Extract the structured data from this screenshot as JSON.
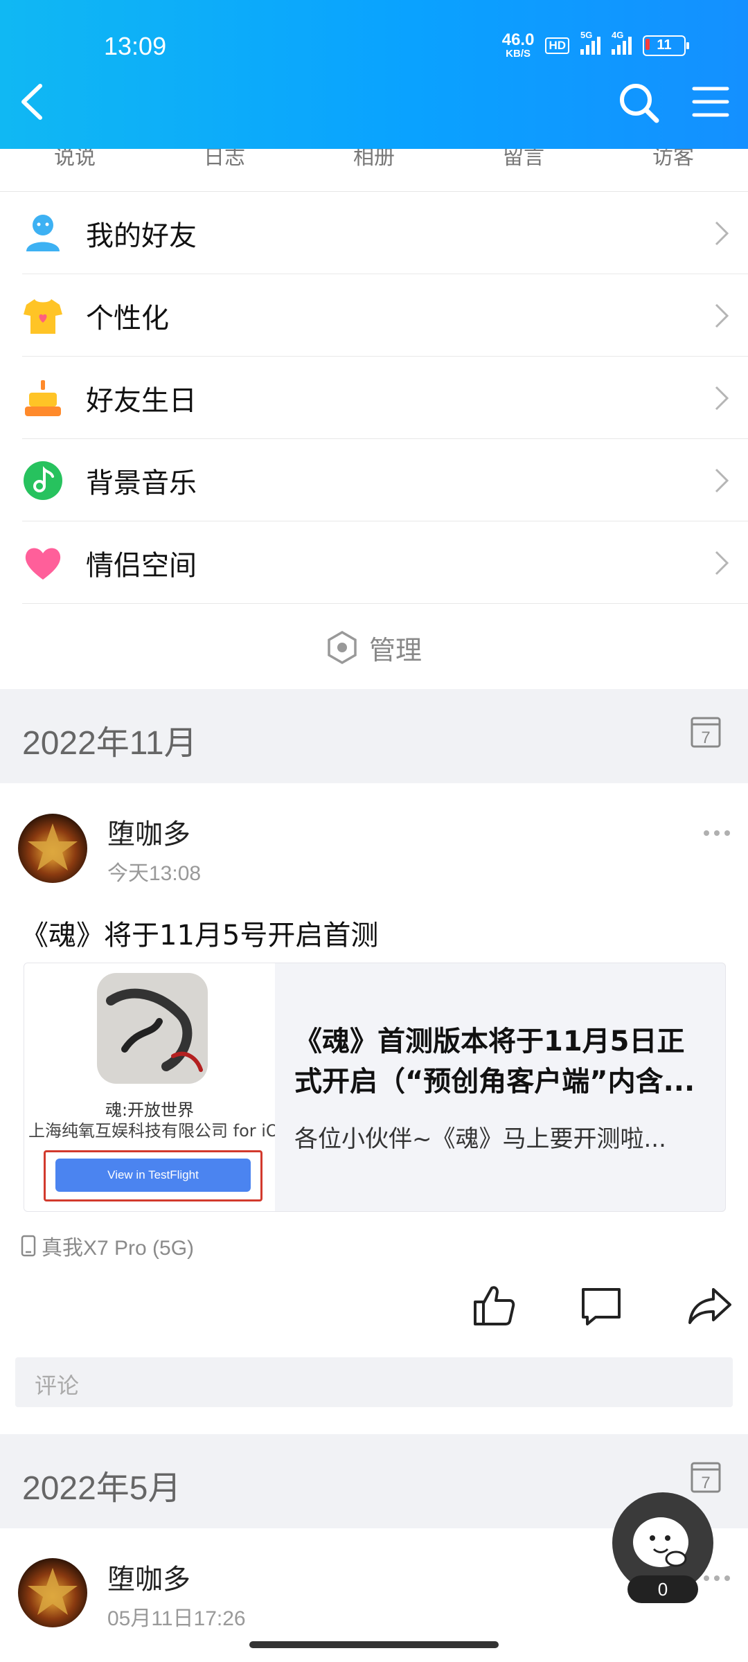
{
  "status_bar": {
    "time": "13:09",
    "net_speed": "46.0",
    "net_unit": "KB/S",
    "hd": "HD",
    "sig1_label": "5G",
    "sig2_label": "4G",
    "battery": "11"
  },
  "tabs": [
    "说说",
    "日志",
    "相册",
    "留言",
    "访客"
  ],
  "menu": [
    {
      "label": "我的好友",
      "icon": "friends-icon",
      "color": "#3db1f3"
    },
    {
      "label": "个性化",
      "icon": "tshirt-icon",
      "color": "#ffc426"
    },
    {
      "label": "好友生日",
      "icon": "birthday-cake-icon",
      "color": "#ff8a2b"
    },
    {
      "label": "背景音乐",
      "icon": "music-note-icon",
      "color": "#27c25e"
    },
    {
      "label": "情侣空间",
      "icon": "heart-icon",
      "color": "#ff5f9a"
    }
  ],
  "manage_label": "管理",
  "months": {
    "first": "2022年11月",
    "second": "2022年5月"
  },
  "calendar_day": "7",
  "post1": {
    "author": "堕咖多",
    "time": "今天13:08",
    "text": "《魂》将于11月5号开启首测",
    "card": {
      "app_name": "魂:开放世界",
      "app_company": "上海纯氧互娱科技有限公司 for iOS",
      "tf_button": "View in TestFlight",
      "title": "《魂》首测版本将于11月5日正式开启（“预创角客户端”内含...",
      "desc": "各位小伙伴~《魂》马上要开测啦..."
    },
    "device": "真我X7 Pro (5G)",
    "comment_placeholder": "评论"
  },
  "post2": {
    "author": "堕咖多",
    "time": "05月11日17:26"
  },
  "floater_count": "0",
  "colors": {
    "topbar": "#10b8f3",
    "band": "#f1f2f5",
    "tf_button": "#4b84f0",
    "tf_frame": "#d23a2d"
  }
}
